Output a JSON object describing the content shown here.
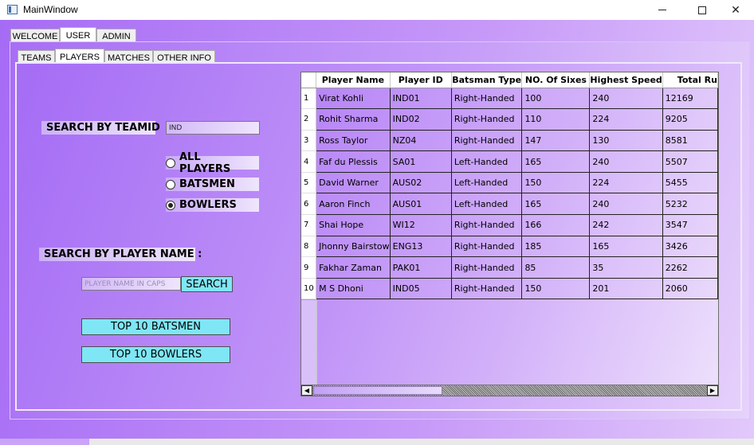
{
  "window": {
    "title": "MainWindow"
  },
  "main_tabs": [
    {
      "label": "WELCOME",
      "active": false
    },
    {
      "label": "USER",
      "active": true
    },
    {
      "label": "ADMIN",
      "active": false
    }
  ],
  "sub_tabs": [
    {
      "label": "TEAMS",
      "active": false
    },
    {
      "label": "PLAYERS",
      "active": true
    },
    {
      "label": "MATCHES",
      "active": false
    },
    {
      "label": "OTHER INFO",
      "active": false
    }
  ],
  "search_team": {
    "label": "SEARCH BY TEAMID",
    "value": "IND"
  },
  "filters": {
    "options": [
      {
        "label": "ALL PLAYERS",
        "checked": false
      },
      {
        "label": "BATSMEN",
        "checked": false
      },
      {
        "label": "BOWLERS",
        "checked": true
      }
    ]
  },
  "search_name": {
    "label": "SEARCH BY PLAYER NAME :",
    "placeholder": "PLAYER NAME IN CAPS",
    "button": "SEARCH"
  },
  "actions": {
    "top_batsmen": "TOP 10 BATSMEN",
    "top_bowlers": "TOP 10 BOWLERS"
  },
  "grid": {
    "columns": [
      "Player Name",
      "Player ID",
      "Batsman Type",
      "NO. Of Sixes",
      "Highest Speed",
      "Total Ru"
    ],
    "rows": [
      [
        "1",
        "Virat Kohli",
        "IND01",
        "Right-Handed",
        "100",
        "240",
        "12169"
      ],
      [
        "2",
        "Rohit Sharma",
        "IND02",
        "Right-Handed",
        "110",
        "224",
        "9205"
      ],
      [
        "3",
        "Ross Taylor",
        "NZ04",
        "Right-Handed",
        "147",
        "130",
        "8581"
      ],
      [
        "4",
        "Faf du Plessis",
        "SA01",
        "Left-Handed",
        "165",
        "240",
        "5507"
      ],
      [
        "5",
        "David Warner",
        "AUS02",
        "Left-Handed",
        "150",
        "224",
        "5455"
      ],
      [
        "6",
        "Aaron Finch",
        "AUS01",
        "Left-Handed",
        "165",
        "240",
        "5232"
      ],
      [
        "7",
        "Shai Hope",
        "WI12",
        "Right-Handed",
        "166",
        "242",
        "3547"
      ],
      [
        "8",
        "Jhonny Bairstow",
        "ENG13",
        "Right-Handed",
        "185",
        "165",
        "3426"
      ],
      [
        "9",
        "Fakhar Zaman",
        "PAK01",
        "Right-Handed",
        "85",
        "35",
        "2262"
      ],
      [
        "10",
        "M S Dhoni",
        "IND05",
        "Right-Handed",
        "150",
        "201",
        "2060"
      ]
    ]
  },
  "icons": {
    "minimize": "minimize-icon",
    "maximize": "maximize-icon",
    "close": "close-icon",
    "scroll_left": "arrow-left-icon",
    "scroll_right": "arrow-right-icon"
  }
}
